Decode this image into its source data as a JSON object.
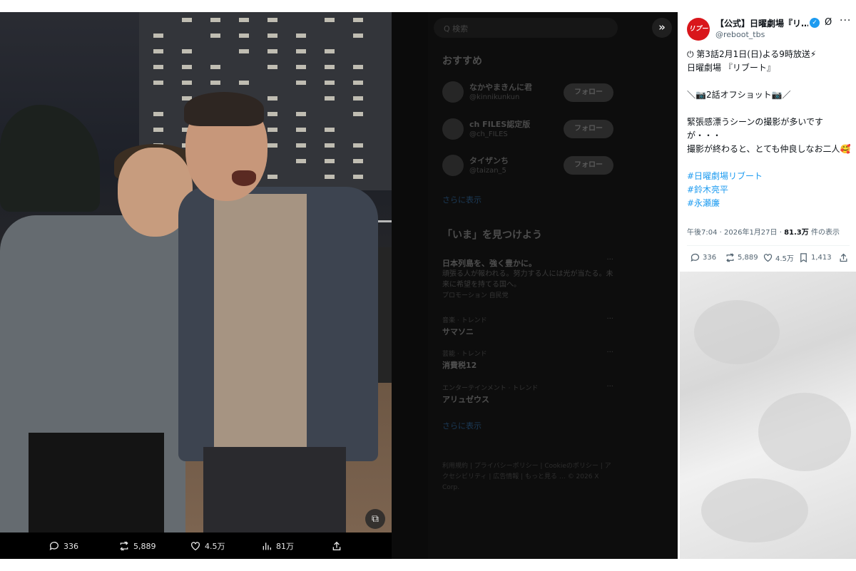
{
  "background_timeline": {
    "search_placeholder": "Q 検索",
    "recommended_heading": "おすすめ",
    "users": [
      {
        "name": "なかやまきんに君",
        "handle": "@kinnikunkun",
        "follow": "フォロー"
      },
      {
        "name": "ch FILES認定版",
        "handle": "@ch_FILES",
        "follow": "フォロー"
      },
      {
        "name": "タイザンち",
        "handle": "@taizan_5",
        "follow": "フォロー"
      }
    ],
    "show_more": "さらに表示",
    "trends_heading": "「いま」を見つけよう",
    "trends": [
      {
        "meta": "",
        "name": "日本列島を、強く豊かに。",
        "desc": "頑張る人が報われる。努力する人には光が当たる。未来に希望を持てる国へ。",
        "promoted": "プロモーション 自民党"
      },
      {
        "meta": "音楽 · トレンド",
        "name": "サマソニ",
        "desc": "",
        "promoted": ""
      },
      {
        "meta": "芸能 · トレンド",
        "name": "消費税12",
        "desc": "",
        "promoted": ""
      },
      {
        "meta": "エンターテインメント · トレンド",
        "name": "アリュゼウス",
        "desc": "",
        "promoted": ""
      }
    ],
    "show_more_2": "さらに表示",
    "footer": "利用規約 | プライバシーポリシー | Cookieのポリシー | アクセシビリティ | 広告情報 | もっと見る … © 2026 X Corp."
  },
  "viewer": {
    "expand_icon": "double-chevron-right-icon",
    "alt_badge": "⧉",
    "actions": {
      "reply": "336",
      "retweet": "5,889",
      "like": "4.5万",
      "views": "81万"
    }
  },
  "tweet": {
    "account_name": "【公式】日曜劇場『リ…",
    "account_handle": "@reboot_tbs",
    "avatar_text": "リブート",
    "brand_color": "#d9161b",
    "lines": [
      "⏻ 第3話2月1日(日)よる9時放送⚡",
      "日曜劇場 『リブート』",
      "",
      "＼📷2話オフショット📷／",
      "",
      "緊張感漂うシーンの撮影が多いですが・・・",
      "撮影が終わると、とても仲良しなお二人🥰"
    ],
    "hashtags": [
      "#日曜劇場リブート",
      "#鈴木亮平",
      "#永瀬廉"
    ],
    "timestamp": "午後7:04 · 2026年1月27日 · ",
    "views_count": "81.3万",
    "views_suffix": " 件の表示",
    "actions": {
      "reply": "336",
      "retweet": "5,889",
      "like": "4.5万",
      "bookmark": "1,413"
    },
    "link_color": "#1d9bf0"
  }
}
